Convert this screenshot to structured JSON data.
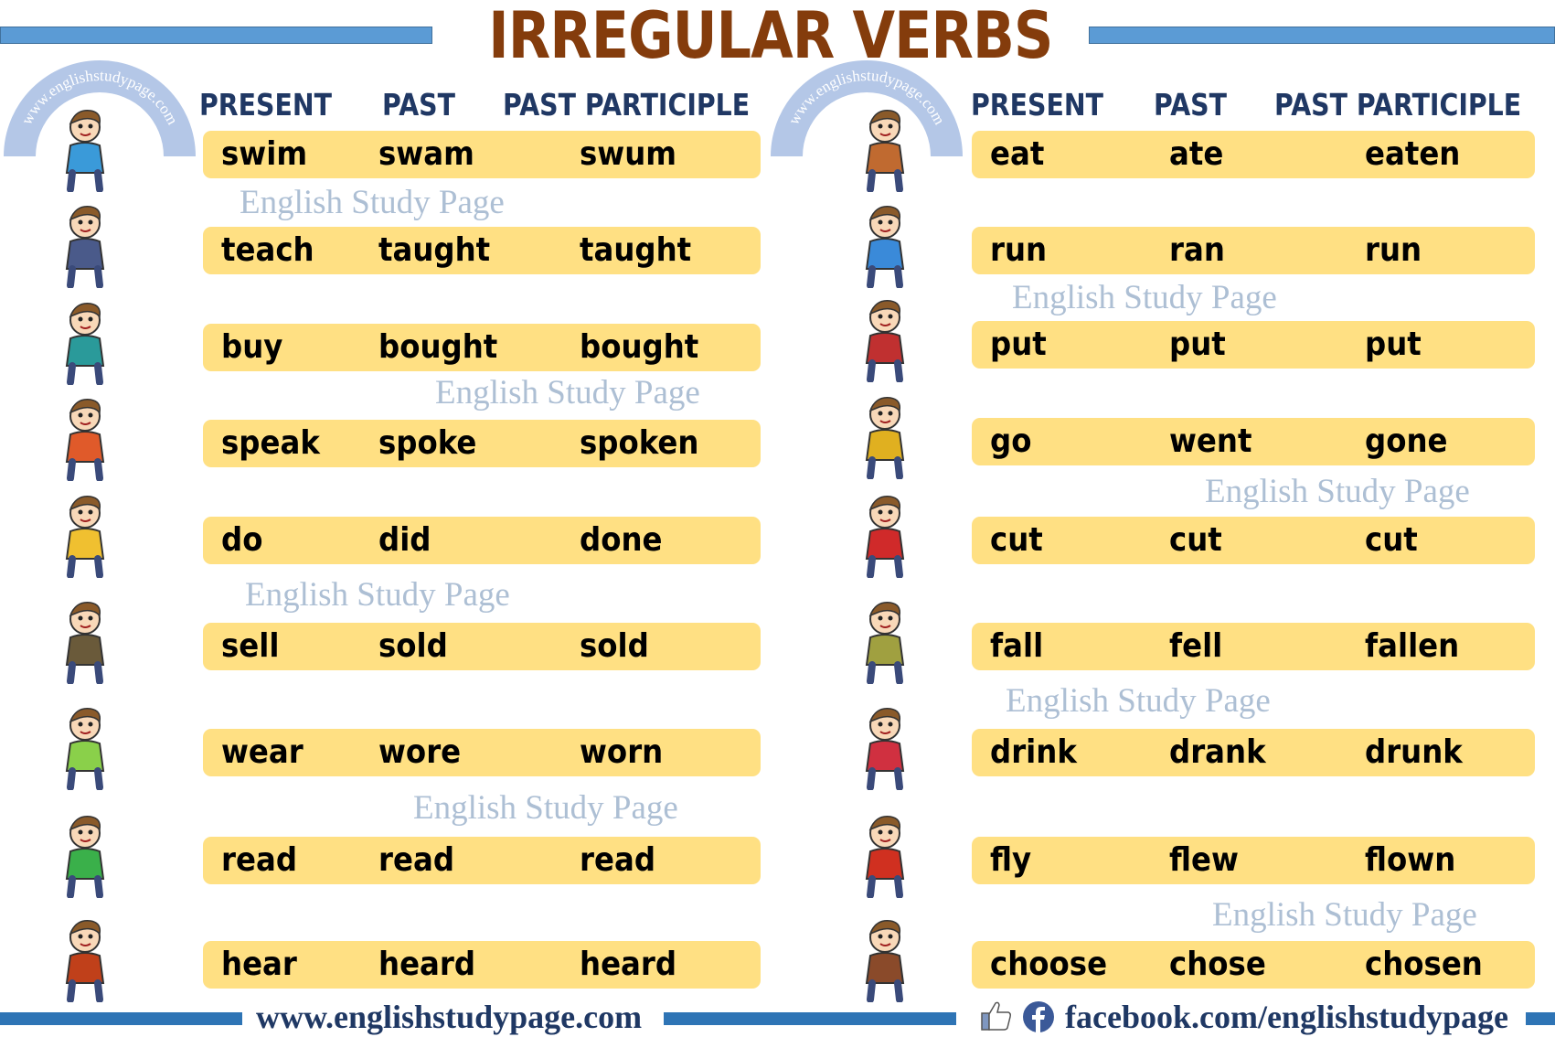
{
  "title": "IRREGULAR VERBS",
  "columns": [
    "PRESENT",
    "PAST",
    "PAST PARTICIPLE"
  ],
  "arc_watermark": "www.englishstudypage.com",
  "watermark_text": "English Study Page",
  "left_verbs": [
    {
      "present": "swim",
      "past": "swam",
      "participle": "swum",
      "illustration": "swimmer-icon"
    },
    {
      "present": "teach",
      "past": "taught",
      "participle": "taught",
      "illustration": "teacher-icon"
    },
    {
      "present": "buy",
      "past": "bought",
      "participle": "bought",
      "illustration": "shopping-cart-icon"
    },
    {
      "present": "speak",
      "past": "spoke",
      "participle": "spoken",
      "illustration": "speaking-girl-icon"
    },
    {
      "present": "do",
      "past": "did",
      "participle": "done",
      "illustration": "studying-boy-icon"
    },
    {
      "present": "sell",
      "past": "sold",
      "participle": "sold",
      "illustration": "apple-seller-icon"
    },
    {
      "present": "wear",
      "past": "wore",
      "participle": "worn",
      "illustration": "girl-with-dresses-icon"
    },
    {
      "present": "read",
      "past": "read",
      "participle": "read",
      "illustration": "reading-boy-icon"
    },
    {
      "present": "hear",
      "past": "heard",
      "participle": "heard",
      "illustration": "big-ear-man-icon"
    }
  ],
  "right_verbs": [
    {
      "present": "eat",
      "past": "ate",
      "participle": "eaten",
      "illustration": "eating-boy-icon"
    },
    {
      "present": "run",
      "past": "ran",
      "participle": "run",
      "illustration": "running-boy-icon"
    },
    {
      "present": "put",
      "past": "put",
      "participle": "put",
      "illustration": "toy-box-boy-icon"
    },
    {
      "present": "go",
      "past": "went",
      "participle": "gone",
      "illustration": "travelling-couple-icon"
    },
    {
      "present": "cut",
      "past": "cut",
      "participle": "cut",
      "illustration": "scissors-ribbon-icon"
    },
    {
      "present": "fall",
      "past": "fell",
      "participle": "fallen",
      "illustration": "falling-boy-icon"
    },
    {
      "present": "drink",
      "past": "drank",
      "participle": "drunk",
      "illustration": "drinking-boy-icon"
    },
    {
      "present": "fly",
      "past": "flew",
      "participle": "flown",
      "illustration": "airplane-pilot-icon"
    },
    {
      "present": "choose",
      "past": "chose",
      "participle": "chosen",
      "illustration": "choosing-doors-icon"
    }
  ],
  "footer": {
    "website": "www.englishstudypage.com",
    "facebook": "facebook.com/englishstudypage"
  },
  "colors": {
    "title": "#843c0c",
    "header_text": "#203864",
    "row_fill": "#ffe083",
    "bar_blue": "#5b9bd5",
    "footer_blue": "#2e74b5",
    "watermark": "#adbfd4",
    "arc": "#b4c7e7"
  }
}
